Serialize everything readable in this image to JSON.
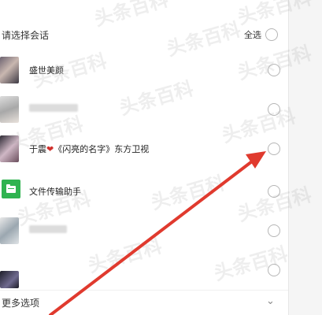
{
  "header": {
    "title": "请选择会话",
    "select_all_label": "全选"
  },
  "conversations": [
    {
      "name": "盛世美颜",
      "redacted": false
    },
    {
      "name": "",
      "redacted": true
    },
    {
      "name_prefix": "于震",
      "name_suffix": "《闪亮的名字》东方卫视",
      "heart": "❤",
      "redacted": false
    },
    {
      "name": "文件传输助手",
      "redacted": false
    },
    {
      "name": "",
      "redacted": true
    },
    {
      "name": "",
      "redacted": true
    }
  ],
  "footer": {
    "more_label": "更多选项",
    "chevron_icon": "chevron-down-icon"
  },
  "annotation": {
    "arrow_color": "#e03a2e"
  },
  "watermark": {
    "text": "头条百科"
  },
  "colors": {
    "file_helper_green": "#2fb350",
    "heart_red": "#d0302d"
  }
}
